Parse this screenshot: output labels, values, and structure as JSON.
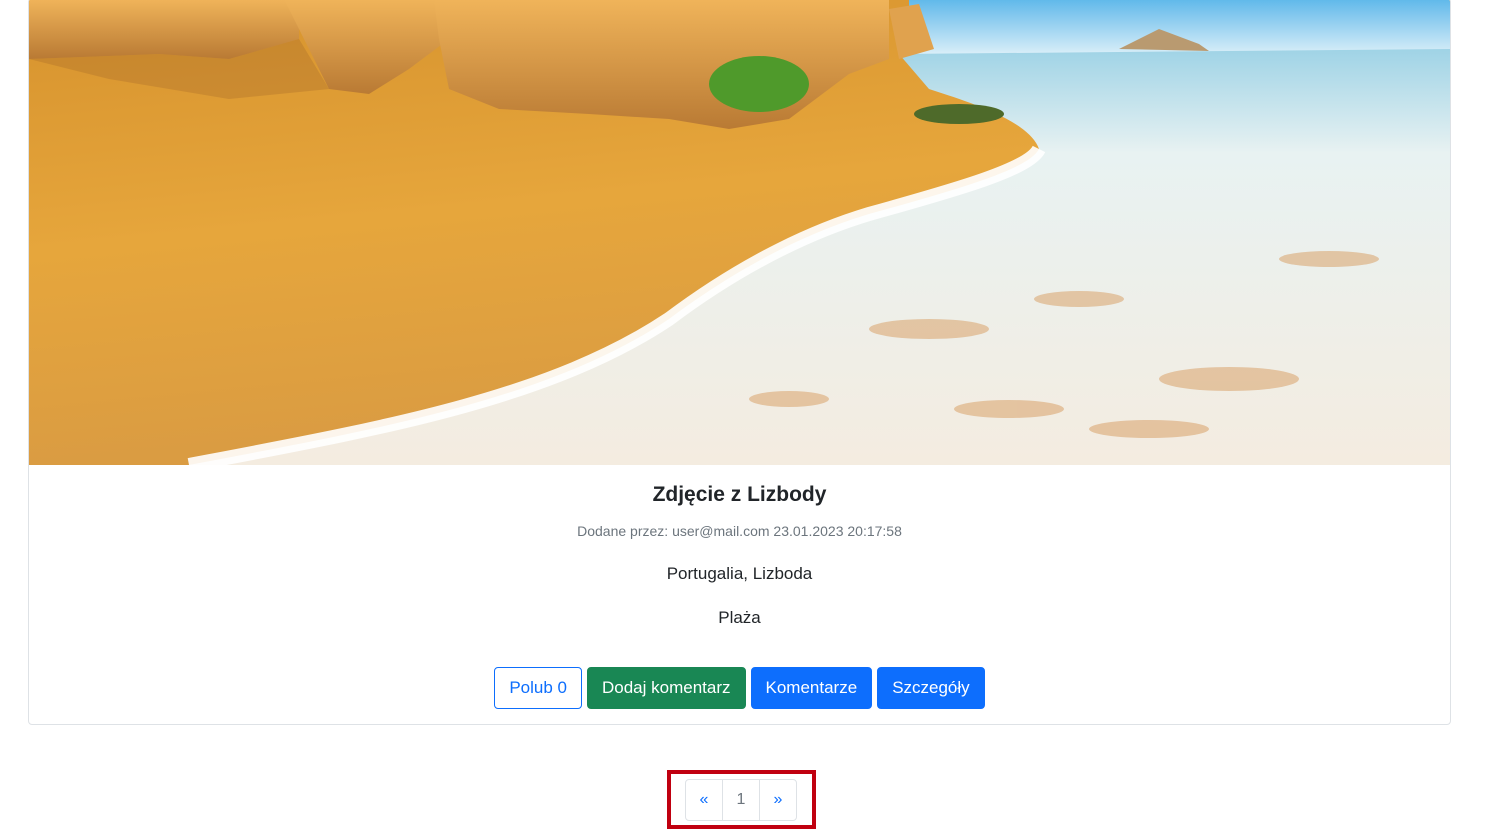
{
  "post": {
    "title": "Zdjęcie z Lizbody",
    "meta": "Dodane przez: user@mail.com 23.01.2023 20:17:58",
    "location": "Portugalia, Lizboda",
    "category": "Plaża"
  },
  "actions": {
    "like_label": "Polub 0",
    "add_comment_label": "Dodaj komentarz",
    "comments_label": "Komentarze",
    "details_label": "Szczegóły"
  },
  "pagination": {
    "prev": "«",
    "page": "1",
    "next": "»"
  },
  "colors": {
    "primary": "#0d6efd",
    "success": "#198754",
    "highlight": "#c00010"
  }
}
